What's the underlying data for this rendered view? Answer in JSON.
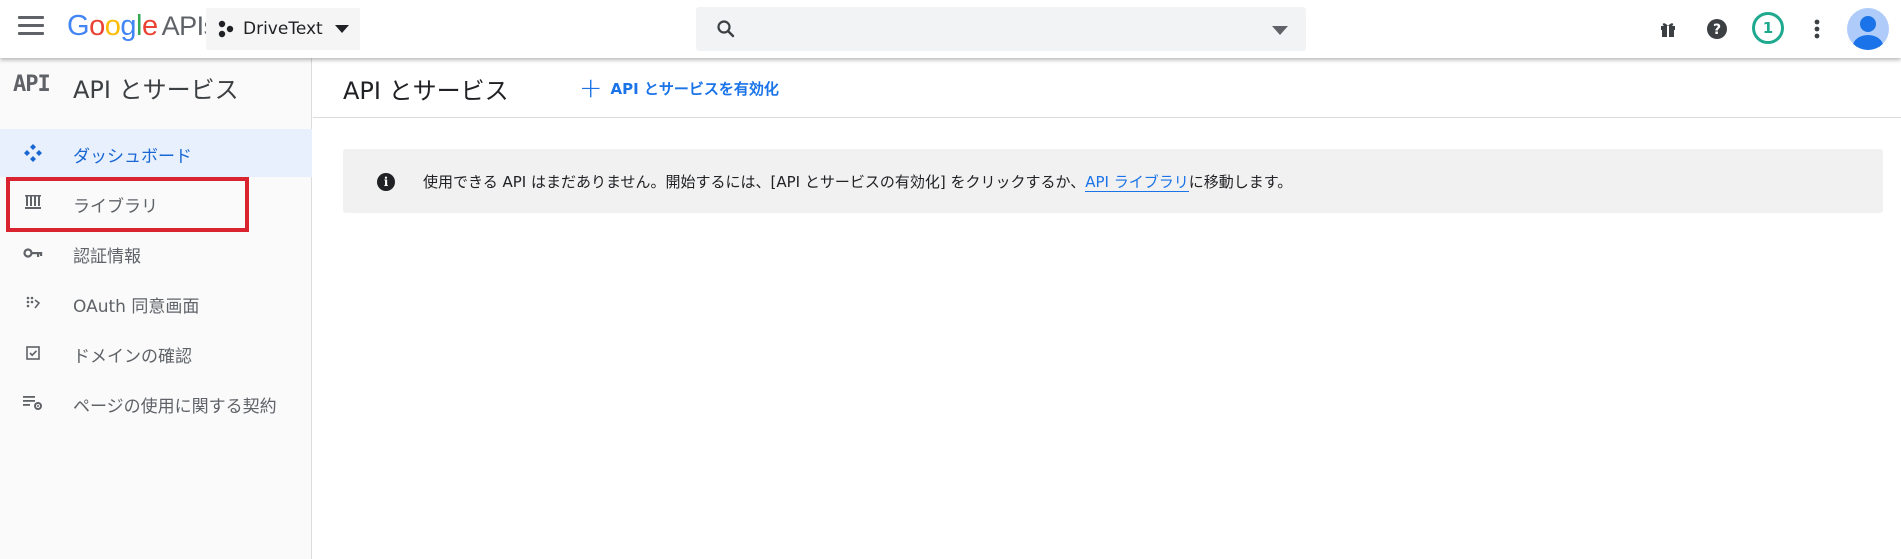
{
  "topbar": {
    "logo_google": "Google",
    "logo_apis": "APIs",
    "project_name": "DriveText",
    "search_placeholder": "",
    "notification_count": "1",
    "icons": [
      "menu-icon",
      "gift-icon",
      "help-icon",
      "more-vert-icon",
      "account-icon"
    ]
  },
  "sidebar": {
    "mark": "API",
    "title": "API とサービス",
    "items": [
      {
        "label": "ダッシュボード",
        "icon": "dashboard-icon",
        "active": true
      },
      {
        "label": "ライブラリ",
        "icon": "library-icon",
        "active": false
      },
      {
        "label": "認証情報",
        "icon": "key-icon",
        "active": false
      },
      {
        "label": "OAuth 同意画面",
        "icon": "oauth-consent-icon",
        "active": false
      },
      {
        "label": "ドメインの確認",
        "icon": "checkbox-icon",
        "active": false
      },
      {
        "label": "ページの使用に関する契約",
        "icon": "settings-list-icon",
        "active": false
      }
    ]
  },
  "main": {
    "title": "API とサービス",
    "enable_label": "API とサービスを有効化",
    "info_text_before": "使用できる API はまだありません。開始するには、[API とサービスの有効化] をクリックするか、",
    "info_link": "API ライブラリ",
    "info_text_after": "に移動します。"
  },
  "colors": {
    "accent": "#1a73e8",
    "active_bg": "#e8f0fe",
    "highlight": "#d9232e",
    "badge": "#1ea98f"
  }
}
